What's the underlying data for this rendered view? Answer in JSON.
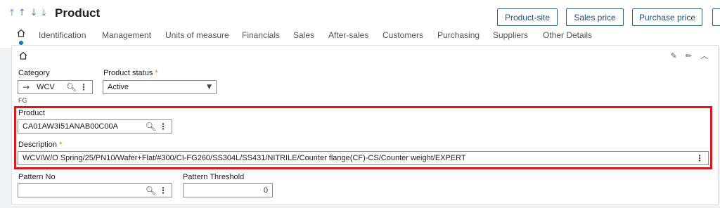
{
  "header": {
    "nav_icons": [
      "arrow-up-to-top-icon",
      "arrow-up-icon",
      "arrow-down-icon",
      "arrow-down-to-bottom-icon"
    ],
    "title": "Product",
    "buttons": {
      "product_site": "Product-site",
      "sales_price": "Sales price",
      "purchase_price": "Purchase price"
    }
  },
  "tabs": [
    "Identification",
    "Management",
    "Units of measure",
    "Financials",
    "Sales",
    "After-sales",
    "Customers",
    "Purchasing",
    "Suppliers",
    "Other Details"
  ],
  "form": {
    "category": {
      "label": "Category",
      "value": "WCV",
      "sub_text": "FG"
    },
    "product_status": {
      "label": "Product status",
      "required_mark": "*",
      "value": "Active"
    },
    "product": {
      "label": "Product",
      "value": "CA01AW3I51ANAB00C00A"
    },
    "description": {
      "label": "Description",
      "required_mark": "*",
      "value": "WCV/W/O Spring/25/PN10/Wafer+Flat/#300/CI-FG260/SS304L/SS431/NITRILE/Counter flange(CF)-CS/Counter weight/EXPERT"
    },
    "pattern_no": {
      "label": "Pattern No",
      "value": ""
    },
    "pattern_threshold": {
      "label": "Pattern Threshold",
      "value": "0"
    }
  },
  "colors": {
    "accent": "#1d6fb8",
    "highlight": "#d7191f",
    "required": "#e07b00"
  }
}
